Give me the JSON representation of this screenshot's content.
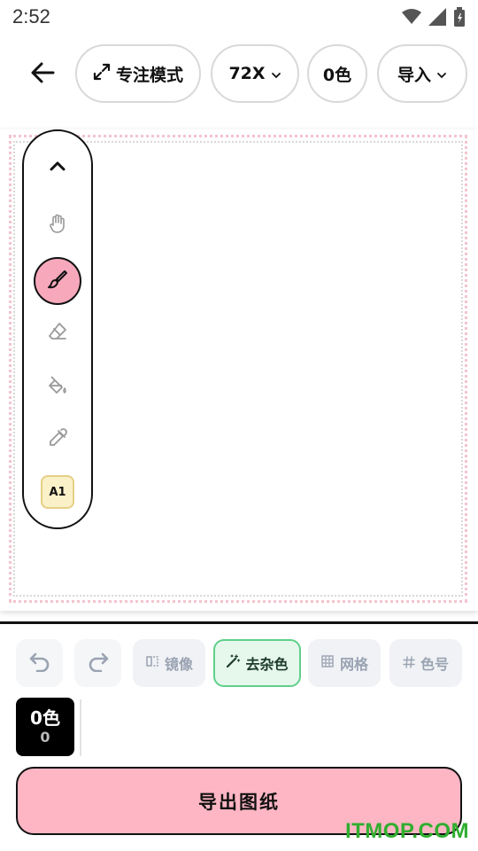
{
  "status_bar": {
    "time": "2:52",
    "icons": [
      "wifi-icon",
      "signal-icon",
      "battery-icon"
    ]
  },
  "top_bar": {
    "back_icon": "arrow-left-icon",
    "focus_mode_label": "专注模式",
    "focus_mode_icon": "expand-icon",
    "size_label": "72X",
    "colors_label": "0色",
    "import_label": "导入"
  },
  "tools": {
    "items": [
      "collapse",
      "hand",
      "brush",
      "eraser",
      "fill",
      "eyedropper",
      "color-label"
    ],
    "active": "brush",
    "color_label_text": "A1"
  },
  "actions": {
    "undo": "undo-icon",
    "redo": "redo-icon",
    "mirror_label": "镜像",
    "denoise_label": "去杂色",
    "grid_label": "网格",
    "color_code_label": "色号"
  },
  "palette": {
    "title": "0色",
    "count": "0"
  },
  "export_label": "导出图纸",
  "watermark": "ITMOP.COM",
  "colors": {
    "accent_pink": "#ffb6c4",
    "brush_active": "#f7a8bb",
    "denoise_green": "#5fd08a",
    "label_yellow": "#fbf1c8",
    "watermark_green": "#2fae2f"
  }
}
